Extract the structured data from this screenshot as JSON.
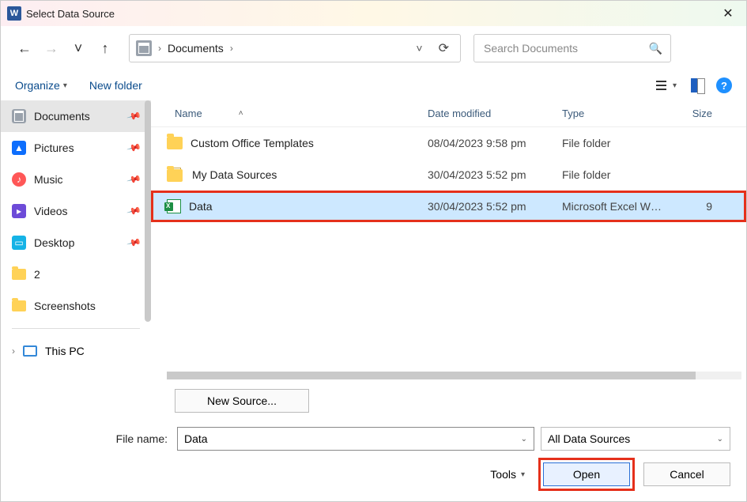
{
  "titlebar": {
    "title": "Select Data Source"
  },
  "nav": {
    "breadcrumb_location": "Documents",
    "search_placeholder": "Search Documents"
  },
  "toolbar": {
    "organize": "Organize",
    "new_folder": "New folder"
  },
  "sidebar": {
    "items": [
      {
        "label": "Documents",
        "pinned": true,
        "icon": "docs",
        "active": true
      },
      {
        "label": "Pictures",
        "pinned": true,
        "icon": "pics"
      },
      {
        "label": "Music",
        "pinned": true,
        "icon": "music"
      },
      {
        "label": "Videos",
        "pinned": true,
        "icon": "videos"
      },
      {
        "label": "Desktop",
        "pinned": true,
        "icon": "desktop"
      },
      {
        "label": "2",
        "pinned": false,
        "icon": "folder"
      },
      {
        "label": "Screenshots",
        "pinned": false,
        "icon": "folder"
      }
    ],
    "this_pc": "This PC"
  },
  "columns": {
    "name": "Name",
    "date": "Date modified",
    "type": "Type",
    "size": "Size"
  },
  "rows": [
    {
      "name": "Custom Office Templates",
      "date": "08/04/2023 9:58 pm",
      "type": "File folder",
      "size": "",
      "icon": "folder"
    },
    {
      "name": "My Data Sources",
      "date": "30/04/2023 5:52 pm",
      "type": "File folder",
      "size": "",
      "icon": "folder-stack"
    },
    {
      "name": "Data",
      "date": "30/04/2023 5:52 pm",
      "type": "Microsoft Excel W…",
      "size": "9",
      "icon": "excel",
      "selected": true,
      "highlight": true
    }
  ],
  "bottom": {
    "new_source": "New Source...",
    "filename_label": "File name:",
    "filename_value": "Data",
    "filetype": "All Data Sources",
    "tools": "Tools",
    "open": "Open",
    "cancel": "Cancel"
  }
}
